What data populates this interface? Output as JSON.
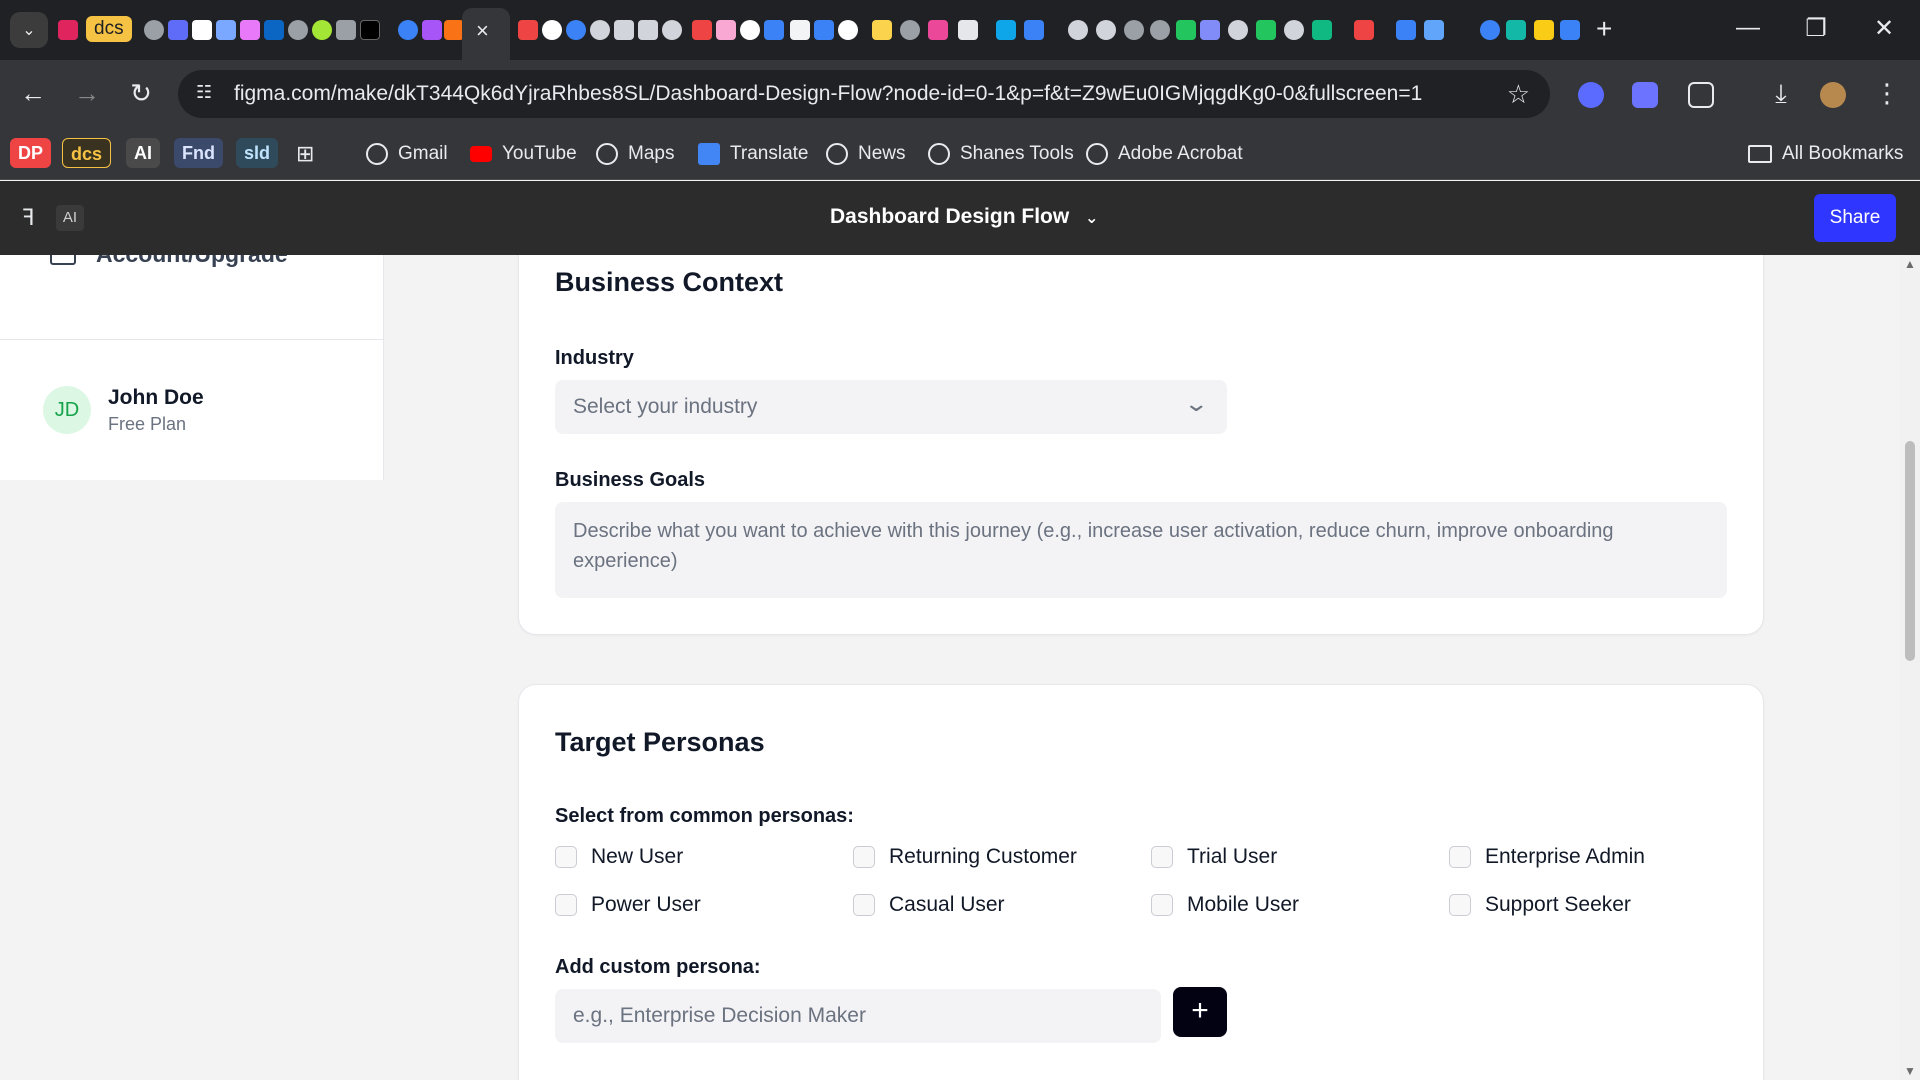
{
  "browser": {
    "tab_menu_icon": "chevron-down-icon",
    "pinned_label": "dcs",
    "active_tab_close": "×",
    "new_tab_label": "+",
    "window_controls": [
      "—",
      "❐",
      "✕"
    ],
    "url": "figma.com/make/dkT344Qk6dYjraRhbes8SL/Dashboard-Design-Flow?node-id=0-1&p=f&t=Z9wEu0IGMjqgdKg0-0&fullscreen=1",
    "back": "←",
    "forward": "→",
    "reload": "↻",
    "star": "☆",
    "menu": "⋮",
    "download": "⤓"
  },
  "bookmarks": {
    "chips": [
      "DP",
      "dcs",
      "AI",
      "Fnd",
      "sld"
    ],
    "items": [
      "Gmail",
      "YouTube",
      "Maps",
      "Translate",
      "News",
      "Shanes Tools",
      "Adobe Acrobat"
    ],
    "all_bookmarks": "All Bookmarks"
  },
  "figma": {
    "ai_tag": "AI",
    "title": "Dashboard Design Flow",
    "title_chevron": "⌄",
    "share_label": "Share"
  },
  "sidebar": {
    "nav_item": "Account/Upgrade",
    "user": {
      "initials": "JD",
      "name": "John Doe",
      "plan": "Free Plan"
    }
  },
  "business_context": {
    "title": "Business Context",
    "industry_label": "Industry",
    "industry_placeholder": "Select your industry",
    "goals_label": "Business Goals",
    "goals_placeholder": "Describe what you want to achieve with this journey (e.g., increase user activation, reduce churn, improve onboarding experience)"
  },
  "target_personas": {
    "title": "Target Personas",
    "select_label": "Select from common personas:",
    "personas": [
      "New User",
      "Returning Customer",
      "Trial User",
      "Enterprise Admin",
      "Power User",
      "Casual User",
      "Mobile User",
      "Support Seeker"
    ],
    "custom_label": "Add custom persona:",
    "custom_placeholder": "e.g., Enterprise Decision Maker",
    "add_icon": "+"
  },
  "colors": {
    "share": "#2f36ff",
    "avatar_bg": "#dcf7e3",
    "avatar_text": "#16a34a",
    "add_button": "#030213"
  }
}
